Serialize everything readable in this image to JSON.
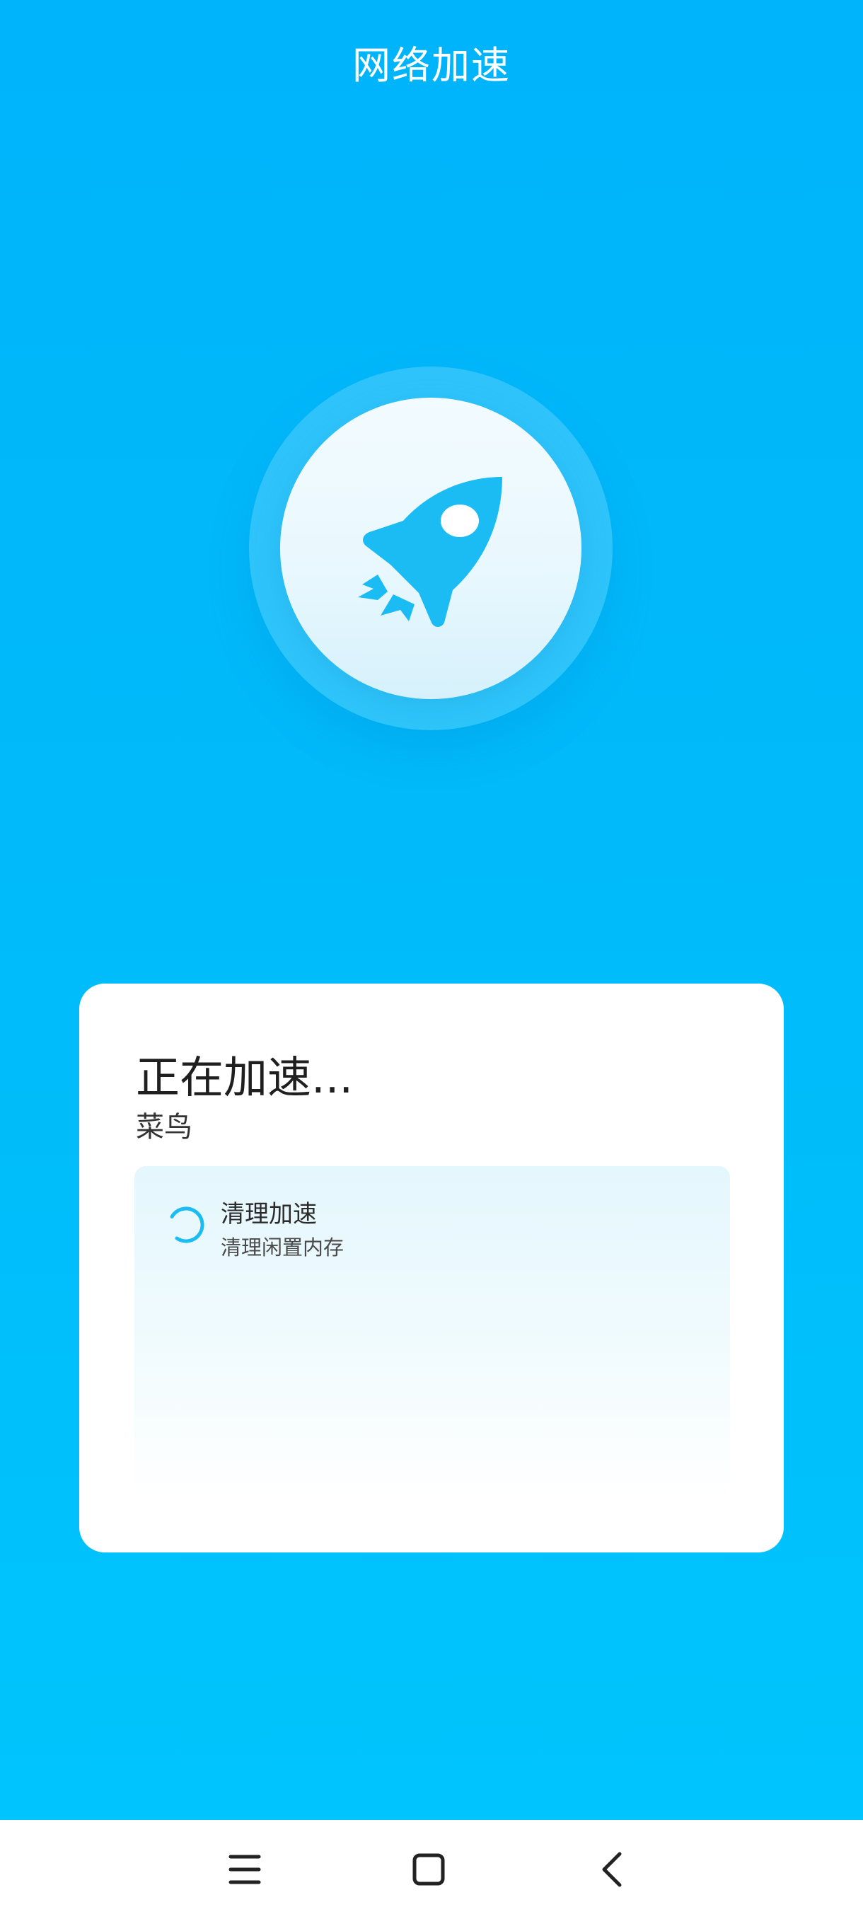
{
  "header": {
    "title": "网络加速"
  },
  "hero": {
    "icon": "rocket-icon",
    "accent_color": "#1bbcf3"
  },
  "card": {
    "status_title": "正在加速...",
    "target_name": "菜鸟",
    "tasks": [
      {
        "title": "清理加速",
        "description": "清理闲置内存",
        "state": "in-progress",
        "icon": "loading-spinner-icon"
      }
    ]
  },
  "navbar": {
    "buttons": [
      {
        "icon": "menu-icon"
      },
      {
        "icon": "home-icon"
      },
      {
        "icon": "back-icon"
      }
    ]
  }
}
